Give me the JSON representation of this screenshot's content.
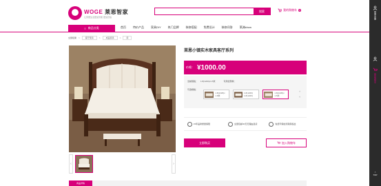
{
  "header": {
    "logo_brand": "WOGE",
    "logo_cn": "莱恩智家",
    "logo_sub": "让家居生活更加智能·更加舒适",
    "search_placeholder": "",
    "search_button": "搜索",
    "cart_label": "我的购物车",
    "cart_count": "0"
  },
  "nav": {
    "category_button": "商品分类",
    "items": [
      "首页",
      "特价产品",
      "家具DIY",
      "热门品牌",
      "装修搭配",
      "免费设计",
      "装修问答",
      "莱渊show"
    ]
  },
  "breadcrumb": {
    "label": "全部结果",
    "level1": "客厅家具",
    "level2": "成品家具",
    "level3": "床"
  },
  "product": {
    "title": "莱恩小镇实木家具客厅系列",
    "price_label": "价格：",
    "price_value": "¥1000.00",
    "stock_label": "当前规格：",
    "stock_value": "1.8(1220)x1.5米",
    "purchase_label": "可用优惠券：",
    "spec_label": "可选规格：",
    "spec_options": [
      {
        "text": "1.8(1220)x 1.8米"
      },
      {
        "text": "1.8(1220) 1.8(1220)"
      },
      {
        "text": "1.8(1220)x 1.5米"
      }
    ],
    "guarantees": [
      "15年品牌质量保障",
      "全国包邮30天无理由退货",
      "免费环保检测真假权益"
    ],
    "buy_button": "立即购买",
    "addcart_button": "加入购物车",
    "detail_tab": "商品详情"
  },
  "sidebar": {
    "items": [
      "登录/注册",
      "我的购物车"
    ],
    "top": "TOP"
  },
  "colors": {
    "brand": "#d7007a",
    "sidebar": "#2b2b2b"
  }
}
